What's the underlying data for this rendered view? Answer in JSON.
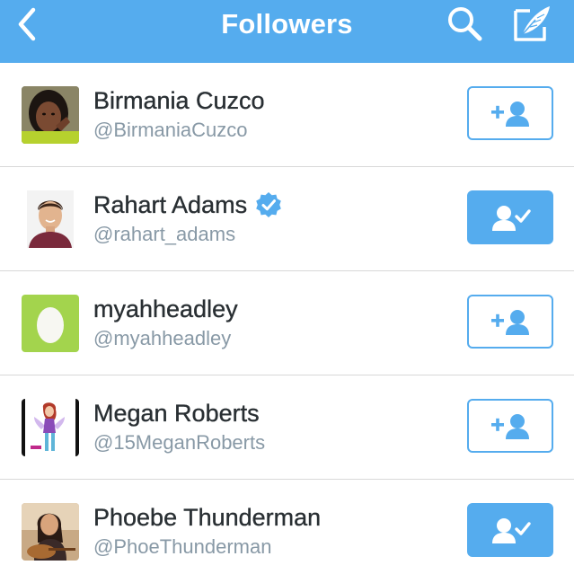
{
  "header": {
    "title": "Followers",
    "back_icon": "chevron-left-icon",
    "search_icon": "search-icon",
    "compose_icon": "compose-quill-icon"
  },
  "colors": {
    "brand": "#55acee",
    "name_text": "#292f33",
    "handle_text": "#8899a6",
    "divider": "#d8d8d8"
  },
  "followers": [
    {
      "name": "Birmania Cuzco",
      "handle": "@BirmaniaCuzco",
      "verified": false,
      "following": false,
      "avatar": "photo-avatar-girl"
    },
    {
      "name": "Rahart Adams",
      "handle": "@rahart_adams",
      "verified": true,
      "following": true,
      "avatar": "photo-avatar-man"
    },
    {
      "name": "myahheadley",
      "handle": "@myahheadley",
      "verified": false,
      "following": false,
      "avatar": "default-egg-avatar"
    },
    {
      "name": "Megan Roberts",
      "handle": "@15MeganRoberts",
      "verified": false,
      "following": false,
      "avatar": "cartoon-fairy-avatar"
    },
    {
      "name": "Phoebe Thunderman",
      "handle": "@PhoeThunderman",
      "verified": false,
      "following": true,
      "avatar": "photo-avatar-guitar"
    }
  ]
}
